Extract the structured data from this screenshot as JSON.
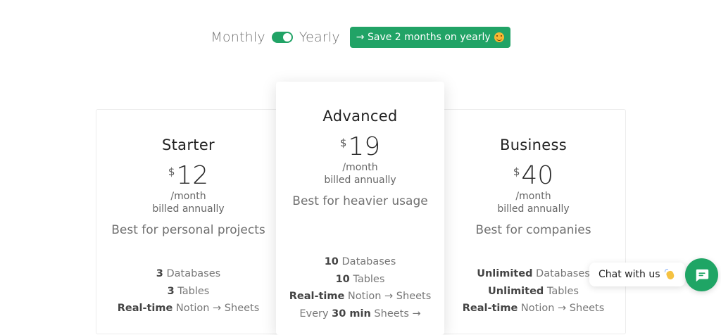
{
  "billing_toggle": {
    "monthly_label": "Monthly",
    "yearly_label": "Yearly",
    "yearly_selected": true,
    "save_badge": "→ Save 2 months on yearly",
    "save_badge_icon": "smiling-face-icon"
  },
  "plans": [
    {
      "name": "Starter",
      "currency": "$",
      "price": "12",
      "period": "/month",
      "billing": "billed annually",
      "description": "Best for personal projects",
      "features": [
        {
          "strong": "3",
          "text": " Databases"
        },
        {
          "strong": "3",
          "text": " Tables"
        },
        {
          "strong": "Real-time",
          "text": " Notion → Sheets"
        }
      ]
    },
    {
      "name": "Advanced",
      "currency": "$",
      "price": "19",
      "period": "/month",
      "billing": "billed annually",
      "description": "Best for heavier usage",
      "features": [
        {
          "strong": "10",
          "text": " Databases"
        },
        {
          "strong": "10",
          "text": " Tables"
        },
        {
          "strong": "Real-time",
          "text": " Notion → Sheets"
        },
        {
          "pre": "Every ",
          "strong": "30 min",
          "text": " Sheets →"
        }
      ]
    },
    {
      "name": "Business",
      "currency": "$",
      "price": "40",
      "period": "/month",
      "billing": "billed annually",
      "description": "Best for companies",
      "features": [
        {
          "strong": "Unlimited",
          "text": " Databases"
        },
        {
          "strong": "Unlimited",
          "text": " Tables"
        },
        {
          "strong": "Real-time",
          "text": " Notion → Sheets"
        }
      ]
    }
  ],
  "chat": {
    "bubble_text": "Chat with us",
    "bubble_icon": "waving-hand-icon",
    "button_icon": "chat-icon"
  },
  "colors": {
    "accent": "#21a366",
    "text_muted": "#707070"
  }
}
